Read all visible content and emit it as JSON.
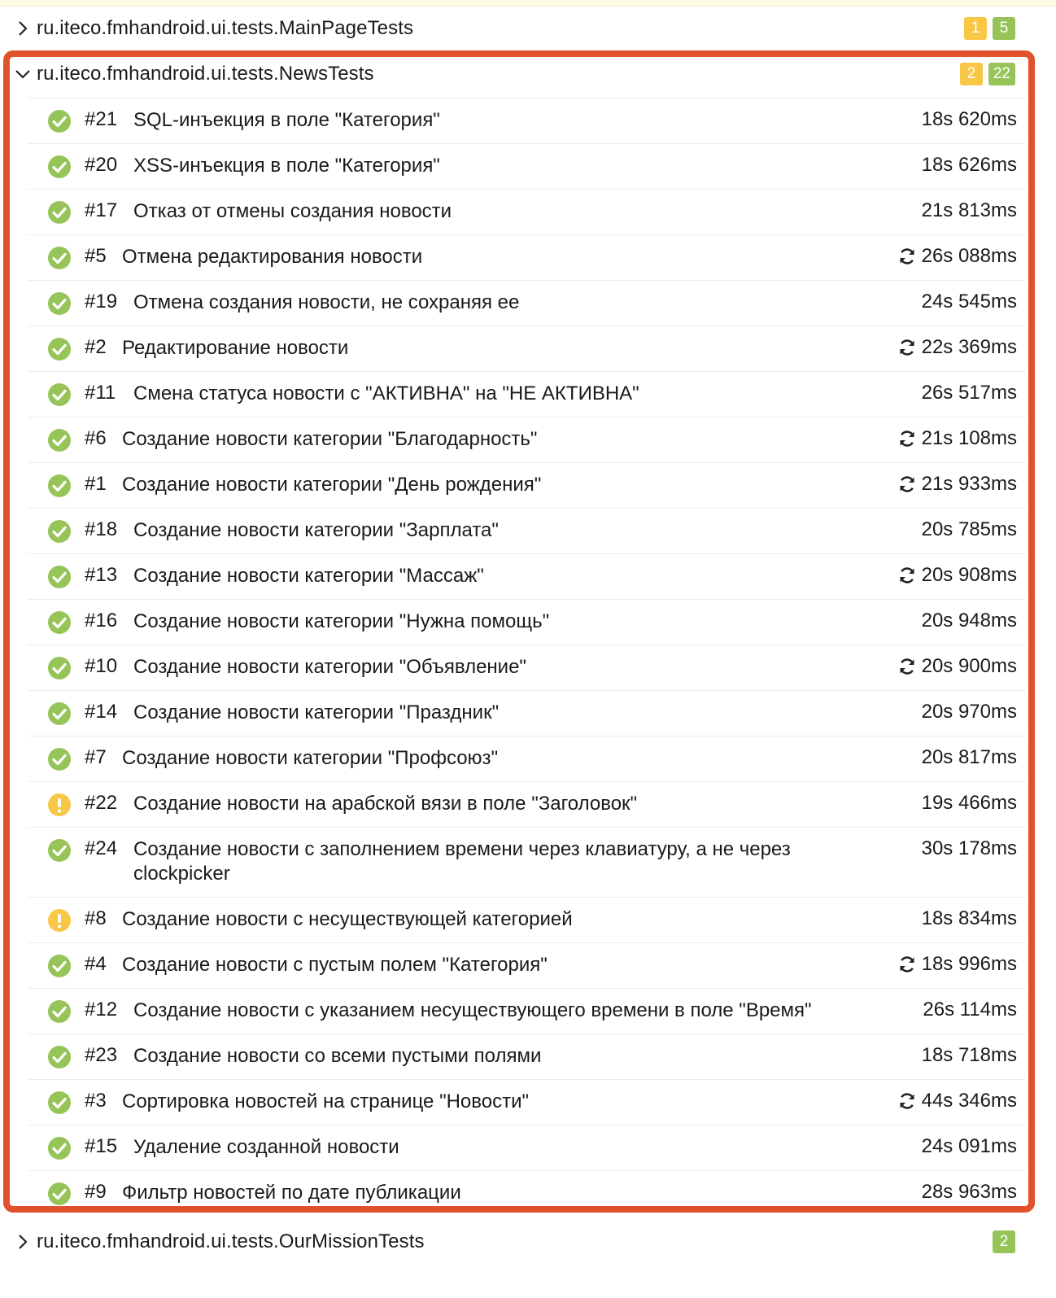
{
  "suites": {
    "main_page": {
      "name": "ru.iteco.fmhandroid.ui.tests.MainPageTests",
      "broken": "1",
      "passed": "5"
    },
    "news": {
      "name": "ru.iteco.fmhandroid.ui.tests.NewsTests",
      "broken": "2",
      "passed": "22"
    },
    "our_mission": {
      "name": "ru.iteco.fmhandroid.ui.tests.OurMissionTests",
      "passed": "2"
    }
  },
  "tests": [
    {
      "num": "#21",
      "title": "SQL-инъекция в поле \"Категория\"",
      "time": "18s 620ms",
      "status": "passed",
      "retried": false
    },
    {
      "num": "#20",
      "title": "XSS-инъекция в поле \"Категория\"",
      "time": "18s 626ms",
      "status": "passed",
      "retried": false
    },
    {
      "num": "#17",
      "title": "Отказ от отмены создания новости",
      "time": "21s 813ms",
      "status": "passed",
      "retried": false
    },
    {
      "num": "#5",
      "title": "Отмена редактирования новости",
      "time": "26s 088ms",
      "status": "passed",
      "retried": true
    },
    {
      "num": "#19",
      "title": "Отмена создания новости, не сохраняя ее",
      "time": "24s 545ms",
      "status": "passed",
      "retried": false
    },
    {
      "num": "#2",
      "title": "Редактирование новости",
      "time": "22s 369ms",
      "status": "passed",
      "retried": true
    },
    {
      "num": "#11",
      "title": "Смена статуса новости с \"АКТИВНА\" на \"НЕ АКТИВНА\"",
      "time": "26s 517ms",
      "status": "passed",
      "retried": false
    },
    {
      "num": "#6",
      "title": "Создание новости категории \"Благодарность\"",
      "time": "21s 108ms",
      "status": "passed",
      "retried": true
    },
    {
      "num": "#1",
      "title": "Создание новости категории \"День рождения\"",
      "time": "21s 933ms",
      "status": "passed",
      "retried": true
    },
    {
      "num": "#18",
      "title": "Создание новости категории \"Зарплата\"",
      "time": "20s 785ms",
      "status": "passed",
      "retried": false
    },
    {
      "num": "#13",
      "title": "Создание новости категории \"Массаж\"",
      "time": "20s 908ms",
      "status": "passed",
      "retried": true
    },
    {
      "num": "#16",
      "title": "Создание новости категории \"Нужна помощь\"",
      "time": "20s 948ms",
      "status": "passed",
      "retried": false
    },
    {
      "num": "#10",
      "title": "Создание новости категории \"Объявление\"",
      "time": "20s 900ms",
      "status": "passed",
      "retried": true
    },
    {
      "num": "#14",
      "title": "Создание новости категории \"Праздник\"",
      "time": "20s 970ms",
      "status": "passed",
      "retried": false
    },
    {
      "num": "#7",
      "title": "Создание новости категории \"Профсоюз\"",
      "time": "20s 817ms",
      "status": "passed",
      "retried": false
    },
    {
      "num": "#22",
      "title": "Создание новости на арабской вязи в поле \"Заголовок\"",
      "time": "19s 466ms",
      "status": "broken",
      "retried": false
    },
    {
      "num": "#24",
      "title": "Создание новости с заполнением времени через клавиатуру, а не через clockpicker",
      "time": "30s 178ms",
      "status": "passed",
      "retried": false
    },
    {
      "num": "#8",
      "title": "Создание новости с несуществующей категорией",
      "time": "18s 834ms",
      "status": "broken",
      "retried": false
    },
    {
      "num": "#4",
      "title": "Создание новости с пустым полем \"Категория\"",
      "time": "18s 996ms",
      "status": "passed",
      "retried": true
    },
    {
      "num": "#12",
      "title": "Создание новости с указанием несуществующего времени в поле \"Время\"",
      "time": "26s 114ms",
      "status": "passed",
      "retried": false
    },
    {
      "num": "#23",
      "title": "Создание новости со всеми пустыми полями",
      "time": "18s 718ms",
      "status": "passed",
      "retried": false
    },
    {
      "num": "#3",
      "title": "Сортировка новостей на странице \"Новости\"",
      "time": "44s 346ms",
      "status": "passed",
      "retried": true
    },
    {
      "num": "#15",
      "title": "Удаление созданной новости",
      "time": "24s 091ms",
      "status": "passed",
      "retried": false
    },
    {
      "num": "#9",
      "title": "Фильтр новостей по дате публикации",
      "time": "28s 963ms",
      "status": "passed",
      "retried": false
    }
  ],
  "colors": {
    "passed": "#97c459",
    "broken": "#f8c745",
    "highlight": "#e0512c"
  },
  "icons": {
    "passed": "check-circle-icon",
    "broken": "exclamation-circle-icon",
    "retry": "refresh-icon",
    "collapsed": "chevron-right-icon",
    "expanded": "chevron-down-icon"
  }
}
